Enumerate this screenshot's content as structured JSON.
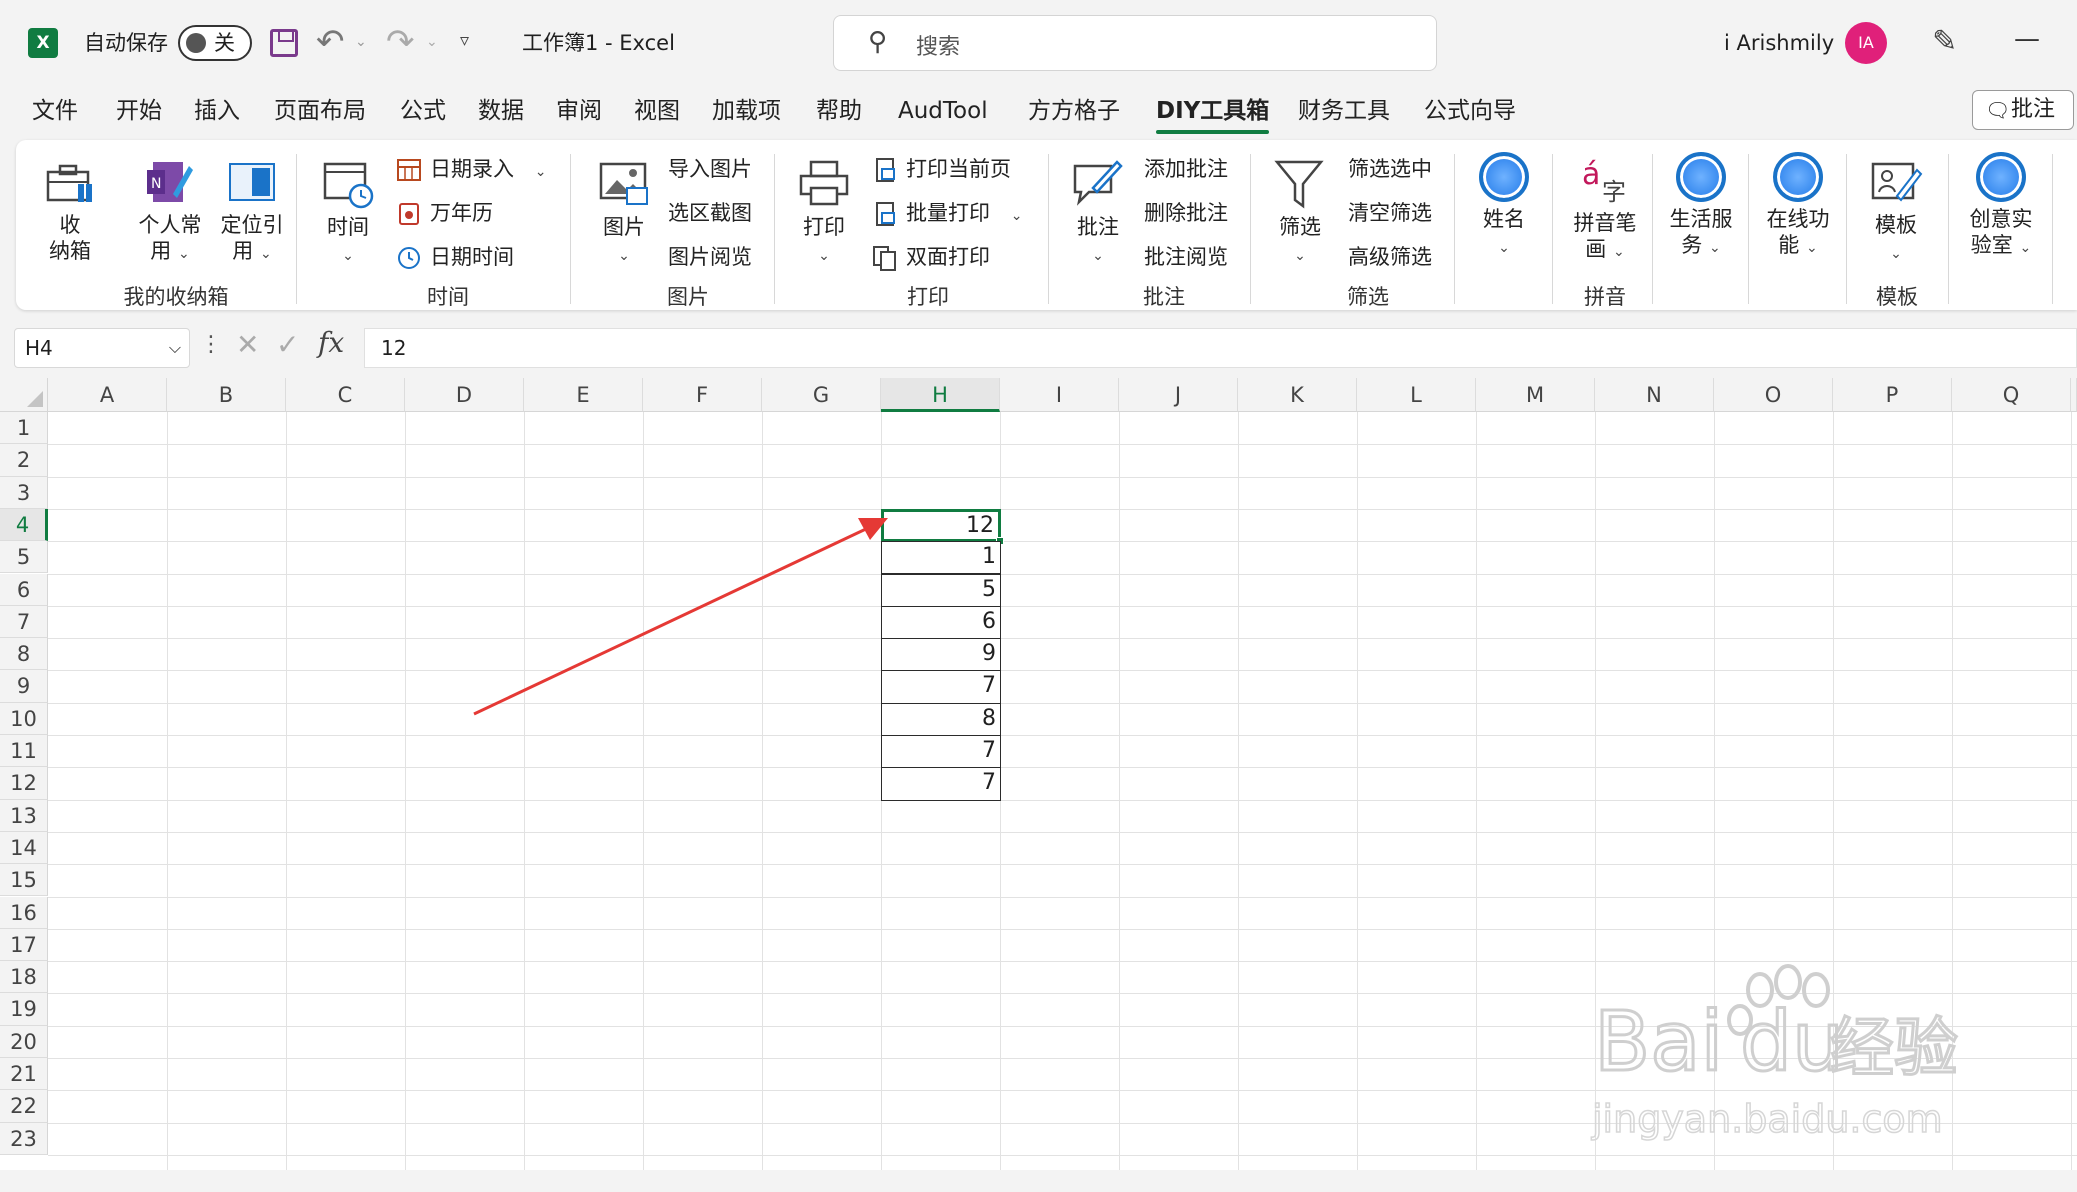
{
  "titlebar": {
    "autosave_label": "自动保存",
    "autosave_state": "关",
    "doc_title": "工作簿1  -  Excel",
    "search_placeholder": "搜索",
    "user_name": "i Arishmily",
    "avatar_initials": "IA",
    "logo_letter": "X"
  },
  "tabs": [
    "文件",
    "开始",
    "插入",
    "页面布局",
    "公式",
    "数据",
    "审阅",
    "视图",
    "加载项",
    "帮助",
    "AudTool",
    "方方格子",
    "DIY工具箱",
    "财务工具",
    "公式向导"
  ],
  "active_tab": "DIY工具箱",
  "comments_button": "批注",
  "ribbon": {
    "storage": {
      "label": "我的收纳箱",
      "btn_collect": "收\n纳箱",
      "btn_personal_1": "个人常",
      "btn_personal_2": "用",
      "btn_locate_1": "定位引",
      "btn_locate_2": "用"
    },
    "time": {
      "label": "时间",
      "btn_time": "时间",
      "date_entry": "日期录入",
      "calendar": "万年历",
      "datetime": "日期时间"
    },
    "picture": {
      "label": "图片",
      "btn_picture": "图片",
      "import": "导入图片",
      "screenshot": "选区截图",
      "viewer": "图片阅览"
    },
    "print": {
      "label": "打印",
      "btn_print": "打印",
      "current_page": "打印当前页",
      "batch": "批量打印",
      "duplex": "双面打印"
    },
    "comment": {
      "label": "批注",
      "btn_comment": "批注",
      "add": "添加批注",
      "delete": "删除批注",
      "view": "批注阅览"
    },
    "filter": {
      "label": "筛选",
      "btn_filter": "筛选",
      "filter_selected": "筛选选中",
      "clear": "清空筛选",
      "advanced": "高级筛选"
    },
    "name": {
      "btn": "姓名"
    },
    "pinyin": {
      "label": "拼音",
      "btn_1": "拼音笔",
      "btn_2": "画"
    },
    "life": {
      "btn_1": "生活服",
      "btn_2": "务"
    },
    "online": {
      "btn_1": "在线功",
      "btn_2": "能"
    },
    "template": {
      "label": "模板",
      "btn": "模板"
    },
    "creative": {
      "btn_1": "创意实",
      "btn_2": "验室"
    }
  },
  "formula_bar": {
    "name_box": "H4",
    "fx": "fx",
    "value": "12"
  },
  "grid": {
    "columns": [
      "A",
      "B",
      "C",
      "D",
      "E",
      "F",
      "G",
      "H",
      "I",
      "J",
      "K",
      "L",
      "M",
      "N",
      "O",
      "P",
      "Q"
    ],
    "rows": [
      "1",
      "2",
      "3",
      "4",
      "5",
      "6",
      "7",
      "8",
      "9",
      "10",
      "11",
      "12",
      "13",
      "14",
      "15",
      "16",
      "17",
      "18",
      "19",
      "20",
      "21",
      "22",
      "23"
    ],
    "selected_column": "H",
    "selected_row": "4",
    "column_h_values": [
      "12",
      "1",
      "5",
      "6",
      "9",
      "7",
      "8",
      "7",
      "7"
    ],
    "values_start_row": 4
  },
  "annotation": {
    "arrow_color": "#e53935"
  },
  "watermark": {
    "brand": "Bai",
    "brand_suffix": "du",
    "brand_cn": "经验",
    "url": "jingyan.baidu.com"
  }
}
